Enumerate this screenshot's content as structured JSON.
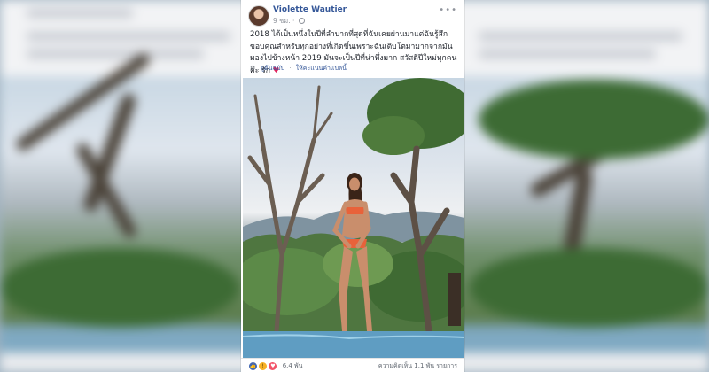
{
  "post": {
    "author": "Violette Wautier",
    "time": "9 ชม.",
    "privacy_icon": "globe-icon",
    "more_icon": "ellipsis-icon",
    "text": "2018 ได้เป็นหนึ่งในปีที่ลำบากที่สุดที่ฉันเคยผ่านมาแต่ฉันรู้สึกขอบคุณสำหรับทุกอย่างที่เกิดขึ้นเพราะฉันเติบโตมามากจากมัน มองไปข้างหน้า 2019 มันจะเป็นปีที่น่าทึ่งมาก สวัสดีปีใหม่ทุกคนค่ะ รัก",
    "heart": "♥",
    "translation": {
      "gear_icon": "gear-icon",
      "see_original": "ดูต้นฉบับ",
      "separator": "·",
      "rate": "ให้คะแนนคำแปลนี้"
    }
  },
  "footer": {
    "reaction_icons": [
      "like-icon",
      "wow-icon",
      "love-icon"
    ],
    "reaction_count": "6.4 พัน",
    "comments_shares": "ความคิดเห็น 1.1 พัน รายการ"
  },
  "colors": {
    "link": "#365899",
    "text": "#1d2129",
    "muted": "#90949c",
    "like": "#4267b2",
    "love": "#f25268",
    "wow": "#f7b125"
  }
}
